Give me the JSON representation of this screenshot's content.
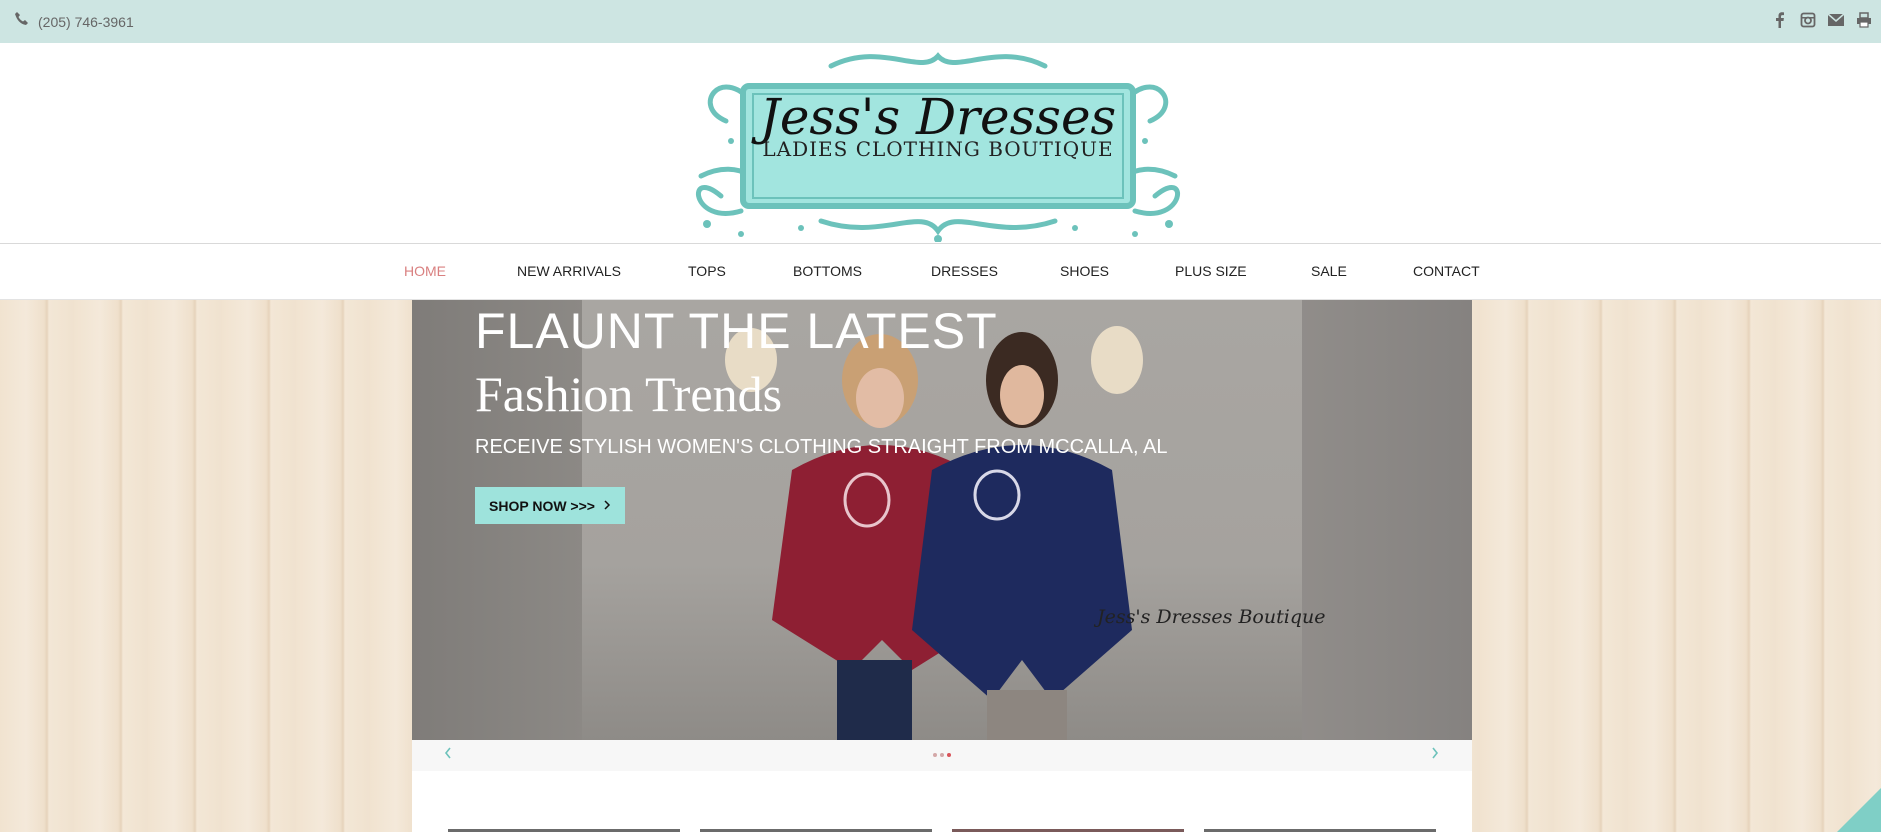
{
  "topbar": {
    "phone": "(205) 746-3961",
    "social_icons": [
      "facebook-icon",
      "instagram-icon",
      "email-icon",
      "print-icon"
    ]
  },
  "logo": {
    "title": "Jess's Dresses",
    "subtitle": "LADIES CLOTHING BOUTIQUE"
  },
  "nav": {
    "items": [
      {
        "label": "HOME",
        "active": true
      },
      {
        "label": "NEW ARRIVALS"
      },
      {
        "label": "TOPS"
      },
      {
        "label": "BOTTOMS"
      },
      {
        "label": "DRESSES"
      },
      {
        "label": "SHOES"
      },
      {
        "label": "PLUS SIZE"
      },
      {
        "label": "SALE"
      },
      {
        "label": "CONTACT"
      }
    ]
  },
  "hero": {
    "title_line1": "FLAUNT THE LATEST",
    "title_line2": "Fashion Trends",
    "subtitle": "RECEIVE STYLISH WOMEN'S CLOTHING STRAIGHT FROM MCCALLA, AL",
    "cta_label": "SHOP NOW >>>",
    "signature": "Jess's Dresses Boutique"
  },
  "slider": {
    "total_slides": 3,
    "active_slide": 3
  },
  "colors": {
    "accent": "#9ee3dc",
    "topbar": "#cde5e2",
    "nav_active": "#d98080",
    "dot_active": "#d9545a"
  }
}
